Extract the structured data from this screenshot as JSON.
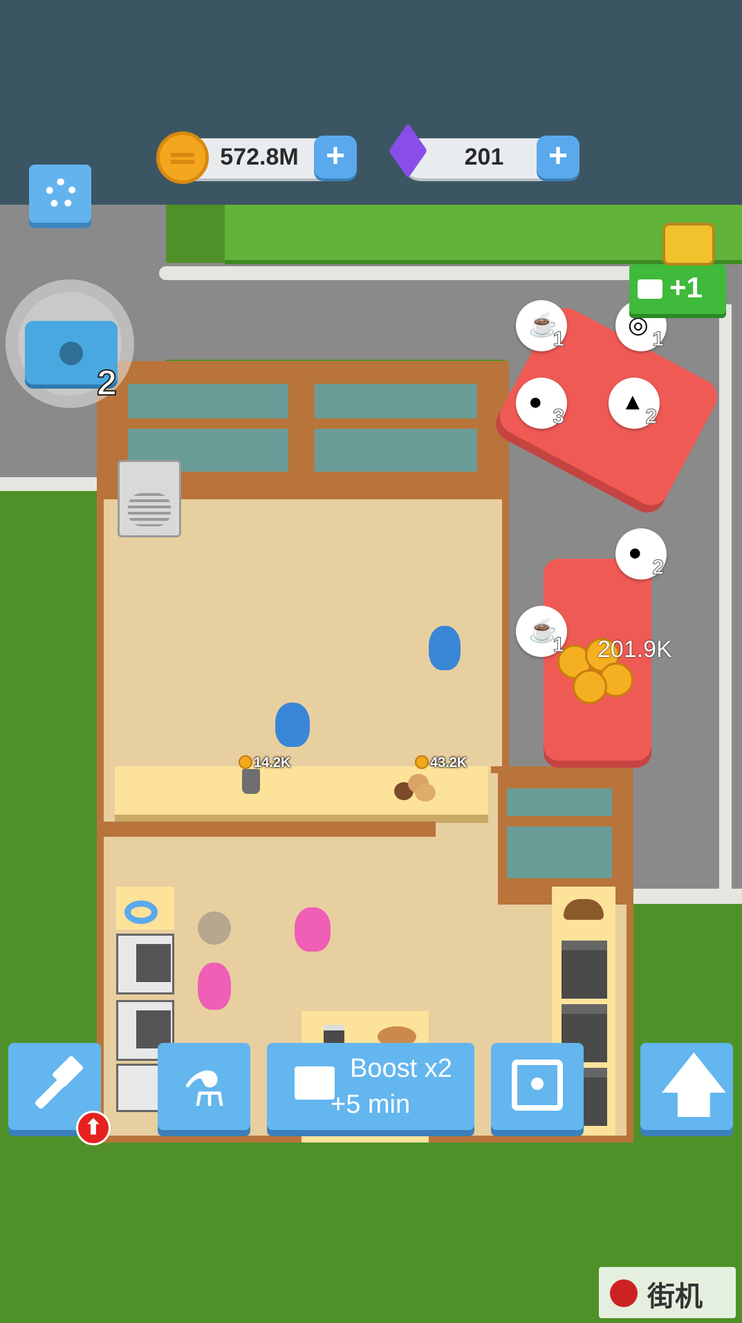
{
  "hud": {
    "coins": "572.8M",
    "gems": "201",
    "coin_plus": "+",
    "gem_plus": "+",
    "toolbox_count": "2",
    "reward_label": "+1"
  },
  "customers": [
    {
      "item": "coffee-icon",
      "count": "1"
    },
    {
      "item": "donut-icon",
      "count": "1"
    },
    {
      "item": "cookie-icon",
      "count": "3"
    },
    {
      "item": "muffin-icon",
      "count": "2"
    },
    {
      "item": "cookie-icon",
      "count": "2"
    },
    {
      "item": "coffee-icon",
      "count": "1"
    }
  ],
  "car_earnings": "201.9K",
  "counter_prices": {
    "coffee": "14.2K",
    "cookies": "43.2K"
  },
  "bottom": {
    "boost_line1": "Boost x2",
    "boost_line2": "+5 min"
  },
  "colors": {
    "topbar": "#3b5662",
    "button": "#64b6ef",
    "car": "#ef5a55",
    "grass": "#4f9128",
    "floor": "#e8cfa0"
  },
  "watermark": "街机"
}
